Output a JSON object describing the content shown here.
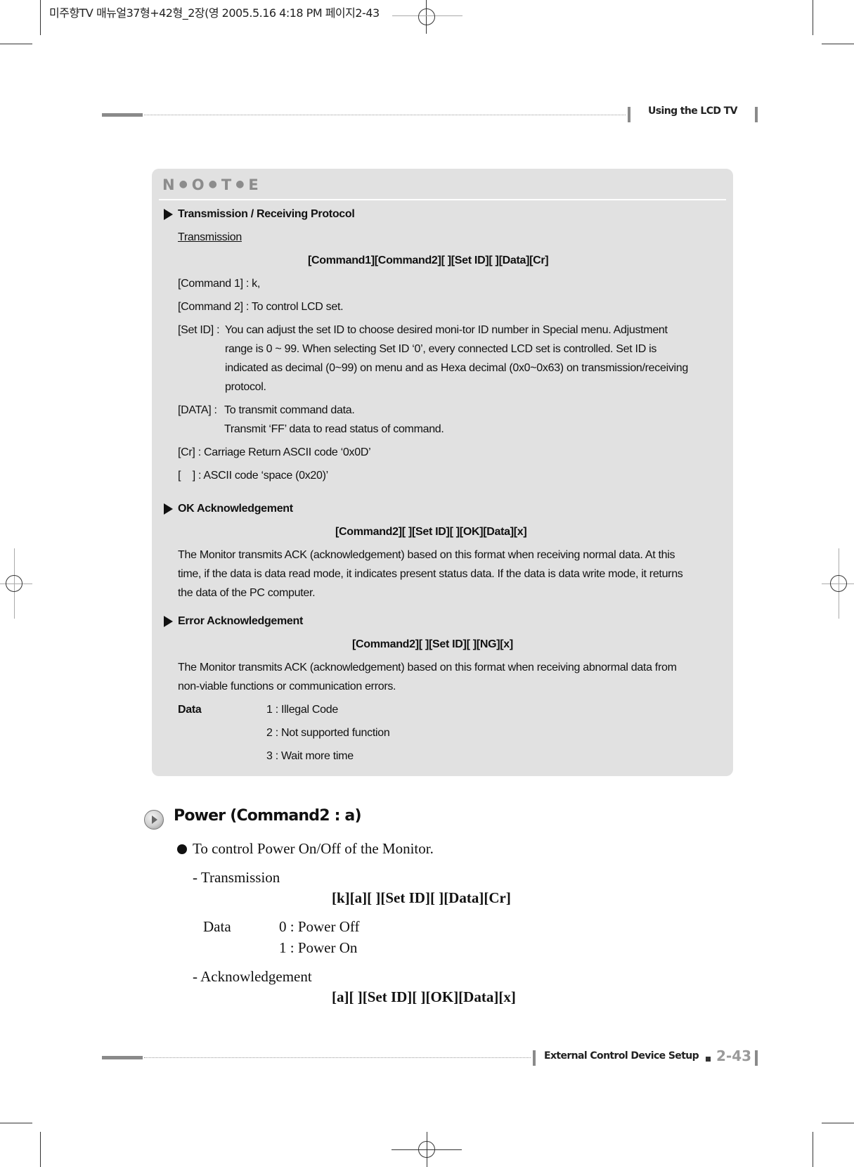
{
  "print_slug": "미주향TV 매뉴얼37형+42형_2장(영   2005.5.16 4:18 PM 페이지2-43",
  "header": {
    "section_title": "Using the LCD TV"
  },
  "note": {
    "title_letters": [
      "N",
      "O",
      "T",
      "E"
    ],
    "transmission_protocol": {
      "heading": "Transmission / Receiving Protocol",
      "subheading": "Transmission",
      "format": "[Command1][Command2][ ][Set ID][ ][Data][Cr]",
      "command1": "[Command 1] : k,",
      "command2": "[Command 2] : To control LCD set.",
      "set_id_label": "[Set ID] : ",
      "set_id_lines": [
        "You can adjust the set ID to choose desired moni-tor ID number in Special menu. Adjustment",
        "range is 0 ~ 99. When selecting Set ID ‘0’, every connected LCD set is controlled. Set ID is",
        "indicated as decimal (0~99) on menu and as Hexa decimal (0x0~0x63) on transmission/receiving",
        "protocol."
      ],
      "data_label": "[DATA] : ",
      "data_lines": [
        "To transmit command data.",
        "Transmit ‘FF’ data to read status of command."
      ],
      "cr": "[Cr] : Carriage Return ASCII code ‘0x0D’",
      "space": "[    ] : ASCII code ‘space (0x20)’"
    },
    "ok_ack": {
      "heading": "OK Acknowledgement",
      "format": "[Command2][ ][Set ID][ ][OK][Data][x]",
      "lines": [
        "The Monitor transmits ACK (acknowledgement) based on this format when receiving normal data. At this",
        "time, if the data is data read mode, it indicates present status data. If the data is data write mode, it returns",
        "the data of the PC computer."
      ]
    },
    "error_ack": {
      "heading": "Error Acknowledgement",
      "format": "[Command2][ ][Set ID][ ][NG][x]",
      "lines": [
        "The Monitor transmits ACK (acknowledgement) based on this format when receiving abnormal data from",
        "non-viable functions or communication errors."
      ],
      "data_label": "Data",
      "data_values": [
        "1 : Illegal Code",
        "2 : Not supported function",
        "3 : Wait more time"
      ]
    }
  },
  "power": {
    "title": "Power (Command2 : a)",
    "description": "To control Power On/Off of the Monitor.",
    "transmission_label": "- Transmission",
    "transmission_format": "[k][a][ ][Set ID][ ][Data][Cr]",
    "data_label": "Data",
    "data_values": [
      "0 : Power Off",
      "1 : Power On"
    ],
    "ack_label": "- Acknowledgement",
    "ack_format": "[a][ ][Set ID][ ][OK][Data][x]"
  },
  "footer": {
    "section_title": "External Control Device Setup",
    "page_number": "2-43"
  }
}
